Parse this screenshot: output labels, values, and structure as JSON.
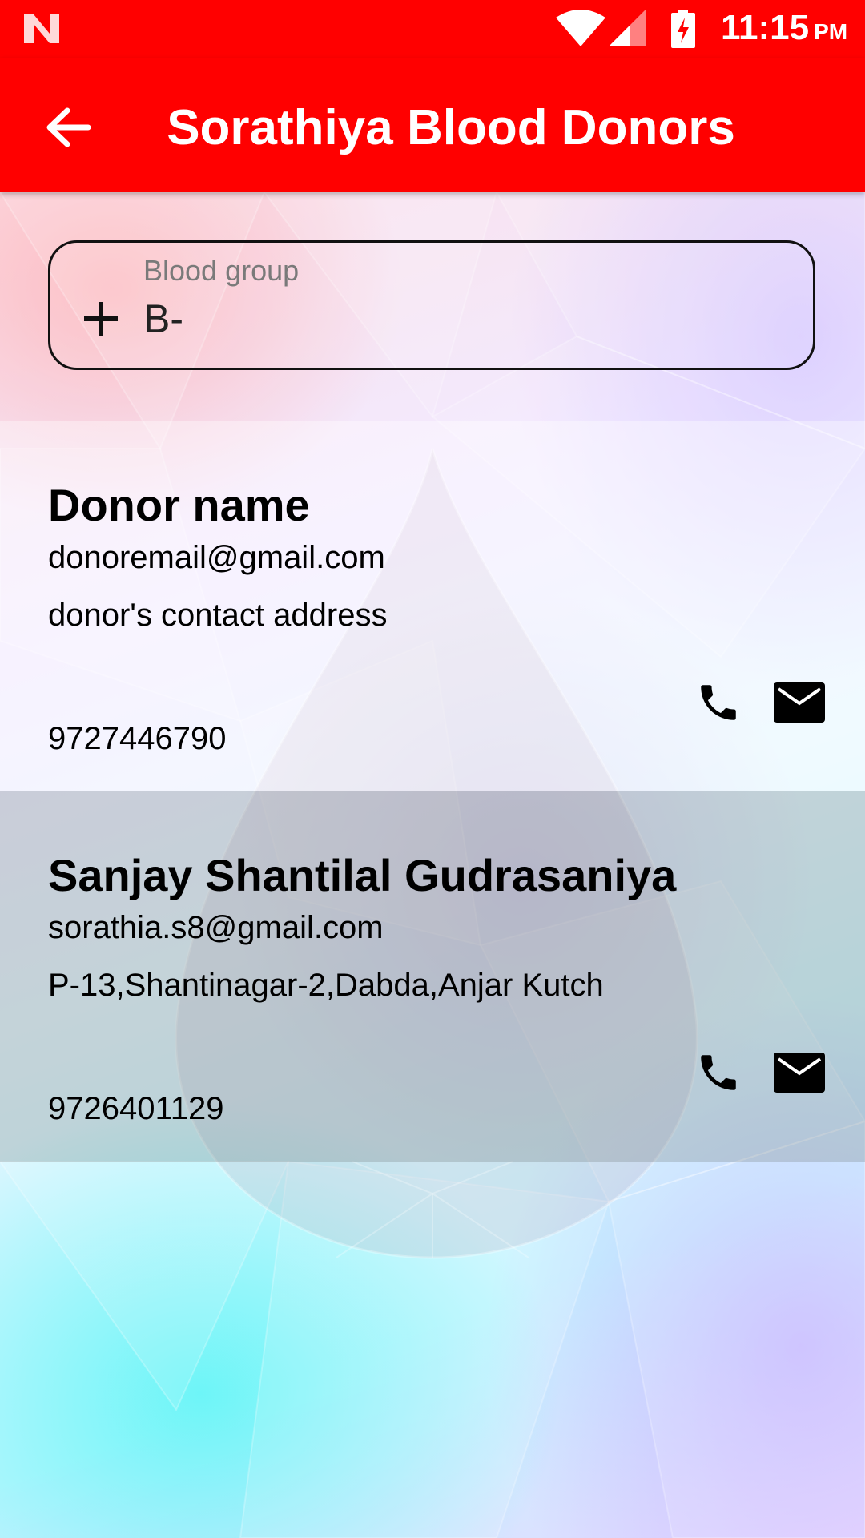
{
  "status_bar": {
    "time": "11:15",
    "ampm": "PM",
    "icons": [
      "notification-n-icon",
      "wifi-icon",
      "cell-signal-icon",
      "battery-charging-icon"
    ]
  },
  "app_bar": {
    "title": "Sorathiya Blood Donors",
    "back_icon": "arrow-back-icon",
    "color": "#ff0000"
  },
  "filter": {
    "label": "Blood group",
    "value": "B-",
    "icon": "plus-icon"
  },
  "donors": [
    {
      "name": "Donor name",
      "email": "donoremail@gmail.com",
      "address": "donor's contact address",
      "phone": "9727446790"
    },
    {
      "name": "Sanjay Shantilal Gudrasaniya",
      "email": "sorathia.s8@gmail.com",
      "address": "P-13,Shantinagar-2,Dabda,Anjar Kutch",
      "phone": "9726401129"
    }
  ]
}
